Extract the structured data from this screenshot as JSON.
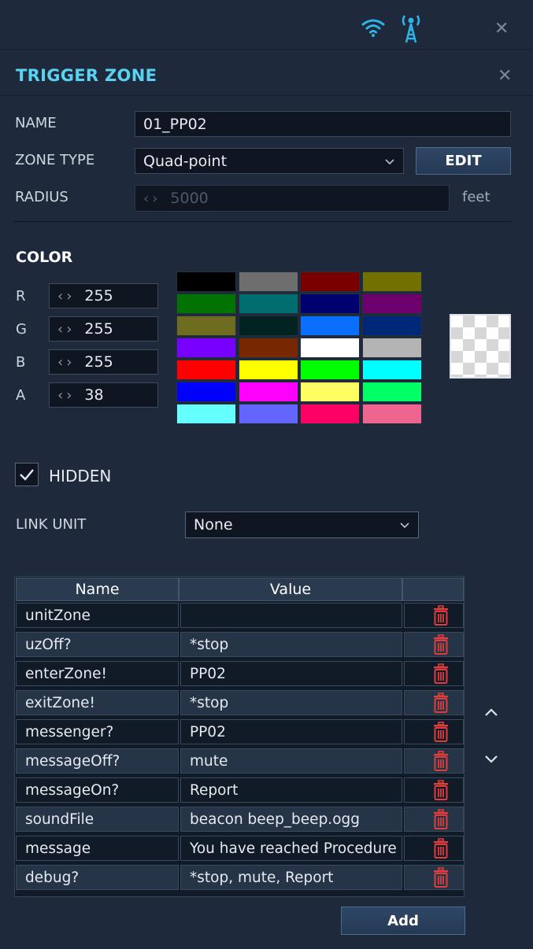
{
  "panel": {
    "title": "TRIGGER ZONE"
  },
  "fields": {
    "name_label": "NAME",
    "name_value": "01_PP02",
    "zone_type_label": "ZONE TYPE",
    "zone_type_value": "Quad-point",
    "edit_label": "EDIT",
    "radius_label": "RADIUS",
    "radius_value": "5000",
    "radius_unit": "feet"
  },
  "color": {
    "heading": "COLOR",
    "channels": [
      {
        "label": "R",
        "value": "255"
      },
      {
        "label": "G",
        "value": "255"
      },
      {
        "label": "B",
        "value": "255"
      },
      {
        "label": "A",
        "value": "38"
      }
    ],
    "palette": [
      "#000000",
      "#6e6e6e",
      "#7a0000",
      "#727000",
      "#007300",
      "#006e6e",
      "#00006e",
      "#6e006e",
      "#6e6c1e",
      "#002321",
      "#0a6eff",
      "#002878",
      "#7800ff",
      "#782800",
      "#ffffff",
      "#b4b4b4",
      "#ff0000",
      "#ffff00",
      "#00ff00",
      "#00ffff",
      "#0000ff",
      "#ff00ff",
      "#ffff64",
      "#00ff64",
      "#64ffff",
      "#6464ff",
      "#ff0064",
      "#f06490"
    ]
  },
  "hidden": {
    "label": "HIDDEN",
    "checked": true
  },
  "link_unit": {
    "label": "LINK UNIT",
    "value": "None"
  },
  "table": {
    "headers": [
      "Name",
      "Value",
      ""
    ],
    "rows": [
      {
        "name": "unitZone",
        "value": ""
      },
      {
        "name": "uzOff?",
        "value": "*stop"
      },
      {
        "name": "enterZone!",
        "value": "PP02"
      },
      {
        "name": "exitZone!",
        "value": "*stop"
      },
      {
        "name": "messenger?",
        "value": "PP02"
      },
      {
        "name": "messageOff?",
        "value": "mute"
      },
      {
        "name": "messageOn?",
        "value": "Report"
      },
      {
        "name": "soundFile",
        "value": "beacon beep_beep.ogg"
      },
      {
        "name": "message",
        "value": "You have reached Procedure"
      },
      {
        "name": "debug?",
        "value": "*stop, mute, Report"
      }
    ]
  },
  "add_label": "Add",
  "icons": [
    "wifi-icon",
    "radio-tower-icon",
    "close-icon",
    "chevron-down-icon",
    "trash-icon",
    "chevron-up-icon",
    "checkmark-icon"
  ],
  "colors": {
    "accent": "#5bd2f0",
    "background": "#1e2a3b",
    "trash": "#e03c3c"
  }
}
